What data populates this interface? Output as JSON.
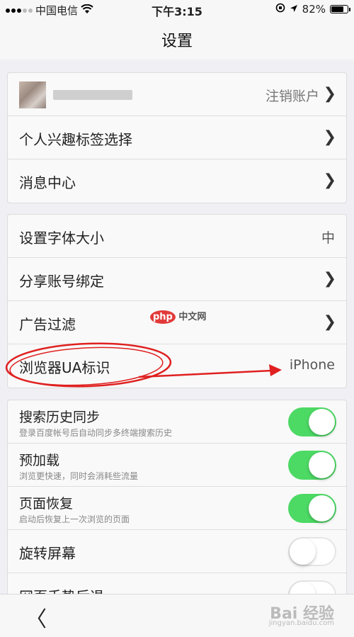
{
  "status_bar": {
    "carrier": "中国电信",
    "time": "下午3:15",
    "battery": "82%",
    "battery_level": 0.82
  },
  "header": {
    "title": "设置"
  },
  "account_group": {
    "logout_label": "注销账户",
    "items": [
      {
        "label": "个人兴趣标签选择"
      },
      {
        "label": "消息中心"
      }
    ]
  },
  "settings_group": {
    "items": [
      {
        "label": "设置字体大小",
        "value": "中"
      },
      {
        "label": "分享账号绑定"
      },
      {
        "label": "广告过滤"
      },
      {
        "label": "浏览器UA标识",
        "value": "iPhone"
      }
    ]
  },
  "toggle_group": {
    "items": [
      {
        "label": "搜索历史同步",
        "sub": "登录百度帐号后自动同步多终端搜索历史",
        "on": true
      },
      {
        "label": "预加载",
        "sub": "浏览更快速，同时会消耗些流量",
        "on": true
      },
      {
        "label": "页面恢复",
        "sub": "启动后恢复上一次浏览的页面",
        "on": true
      },
      {
        "label": "旋转屏幕",
        "on": false
      },
      {
        "label": "网页手势后退",
        "on": false
      }
    ]
  },
  "bottom_bar": {
    "back_glyph": "〈"
  },
  "watermarks": {
    "php_badge": "php",
    "php_site": "中文网",
    "baidu": "Bai 经验",
    "baidu_url": "jingyan.baidu.com"
  },
  "colors": {
    "toggle_on": "#4cd964",
    "annotation_red": "#e02020"
  }
}
